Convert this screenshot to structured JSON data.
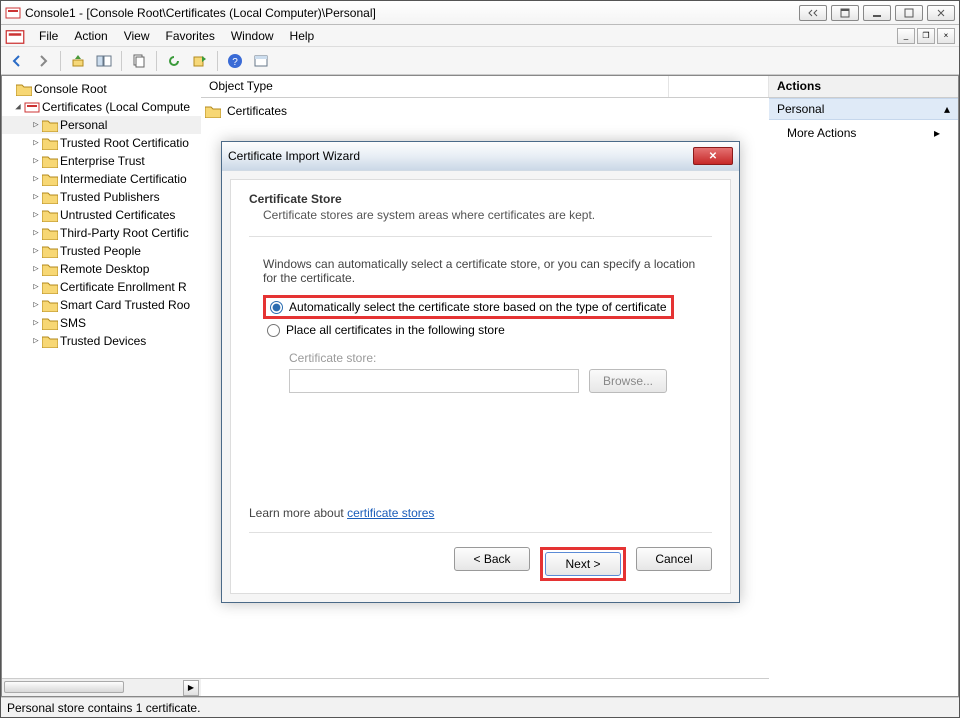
{
  "titlebar": {
    "text": "Console1 - [Console Root\\Certificates (Local Computer)\\Personal]"
  },
  "menubar": {
    "items": [
      "File",
      "Action",
      "View",
      "Favorites",
      "Window",
      "Help"
    ]
  },
  "tree": {
    "root": "Console Root",
    "certs": "Certificates (Local Compute",
    "nodes": [
      "Personal",
      "Trusted Root Certificatio",
      "Enterprise Trust",
      "Intermediate Certificatio",
      "Trusted Publishers",
      "Untrusted Certificates",
      "Third-Party Root Certific",
      "Trusted People",
      "Remote Desktop",
      "Certificate Enrollment R",
      "Smart Card Trusted Roo",
      "SMS",
      "Trusted Devices"
    ]
  },
  "list": {
    "header_col": "Object Type",
    "row0": "Certificates"
  },
  "actions": {
    "title": "Actions",
    "scope": "Personal",
    "item0": "More Actions"
  },
  "status": {
    "text": "Personal store contains 1 certificate."
  },
  "dialog": {
    "title": "Certificate Import Wizard",
    "section_title": "Certificate Store",
    "section_desc": "Certificate stores are system areas where certificates are kept.",
    "para": "Windows can automatically select a certificate store, or you can specify a location for the certificate.",
    "radio_auto": "Automatically select the certificate store based on the type of certificate",
    "radio_place": "Place all certificates in the following store",
    "store_label": "Certificate store:",
    "browse": "Browse...",
    "learn_prefix": "Learn more about ",
    "learn_link": "certificate stores",
    "back": "< Back",
    "next": "Next >",
    "cancel": "Cancel"
  }
}
